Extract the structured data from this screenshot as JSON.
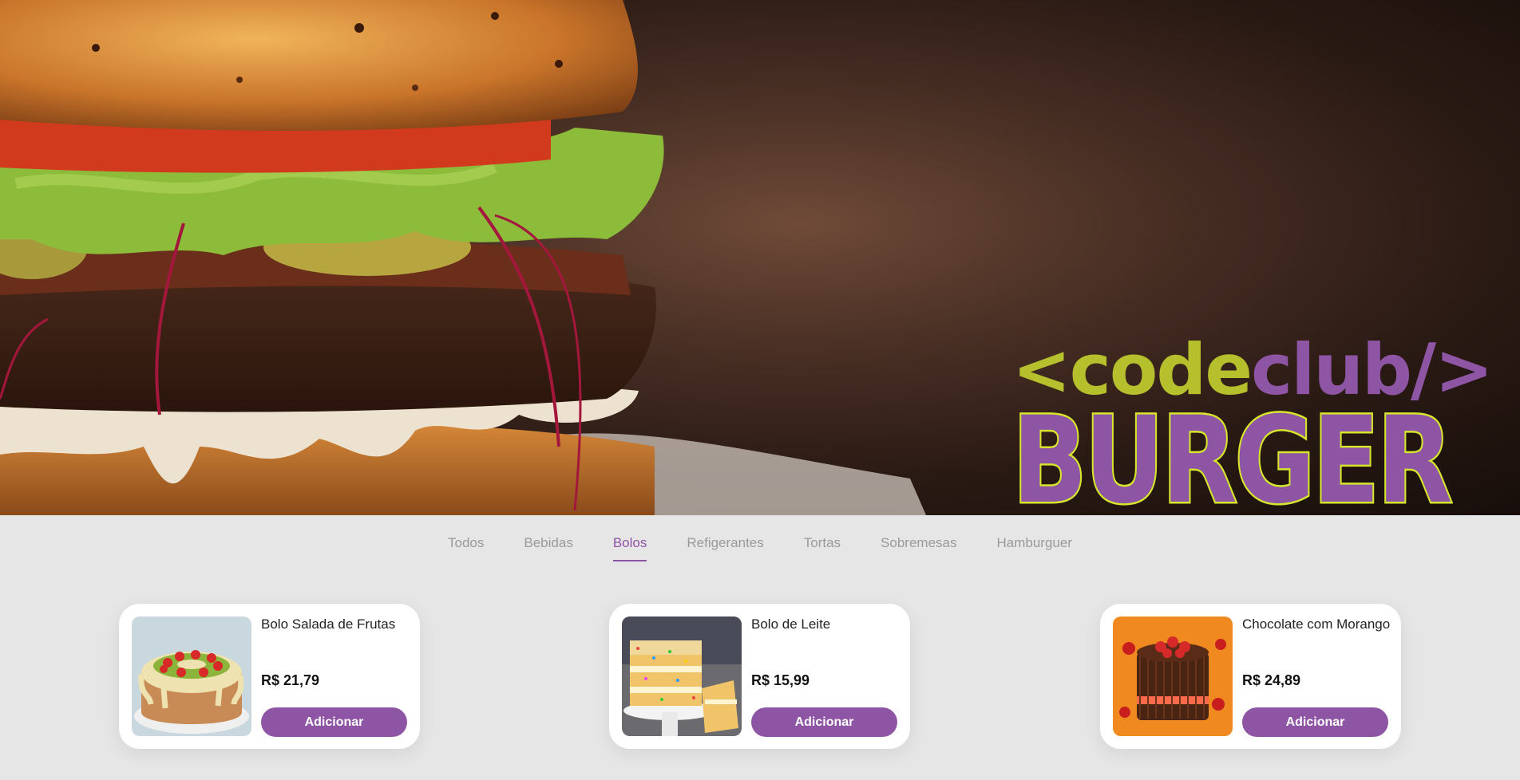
{
  "brand": {
    "logo_top_left": "<code",
    "logo_top_right": "club/>",
    "logo_bottom": "BURGER",
    "colors": {
      "lime": "#b5c02c",
      "purple": "#8f55a5"
    }
  },
  "tabs": [
    {
      "label": "Todos",
      "active": false
    },
    {
      "label": "Bebidas",
      "active": false
    },
    {
      "label": "Bolos",
      "active": true
    },
    {
      "label": "Refigerantes",
      "active": false
    },
    {
      "label": "Tortas",
      "active": false
    },
    {
      "label": "Sobremesas",
      "active": false
    },
    {
      "label": "Hamburguer",
      "active": false
    }
  ],
  "products": [
    {
      "name": "Bolo Salada de Frutas",
      "price": "R$ 21,79",
      "button": "Adicionar"
    },
    {
      "name": "Bolo de Leite",
      "price": "R$ 15,99",
      "button": "Adicionar"
    },
    {
      "name": "Chocolate com Morango",
      "price": "R$ 24,89",
      "button": "Adicionar"
    }
  ]
}
